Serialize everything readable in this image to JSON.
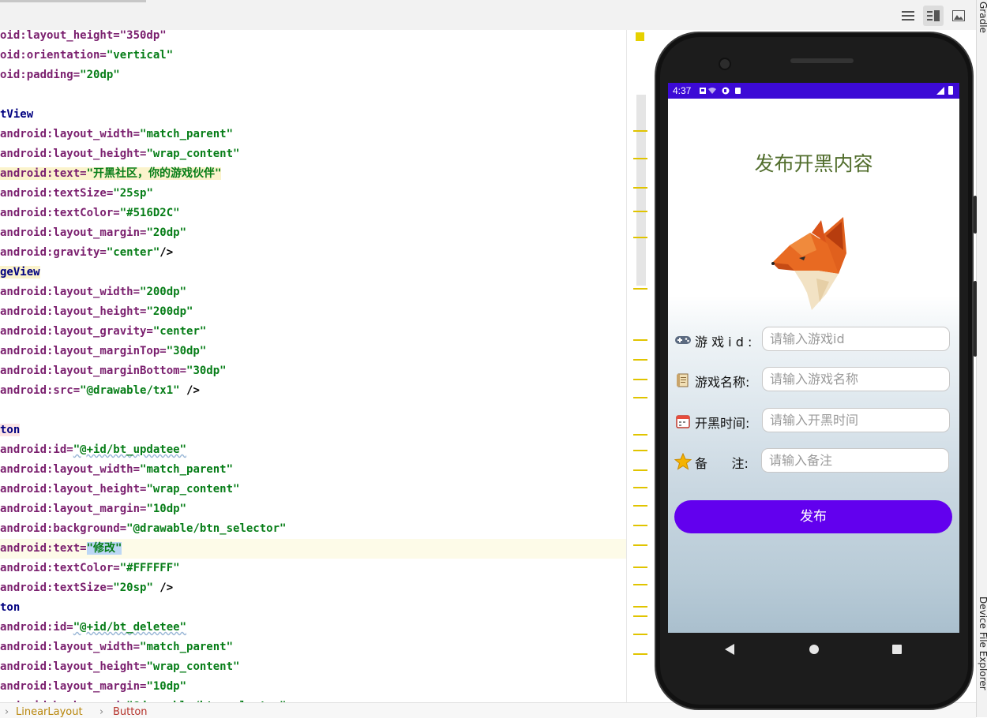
{
  "ide": {
    "side_labels": {
      "gradle": "Gradle",
      "device_explorer": "Device File Explorer"
    },
    "breadcrumb": [
      "LinearLayout",
      "Button"
    ],
    "code_lines": [
      {
        "parts": [
          [
            "attr",
            "oid:layout_height=\"350dp\""
          ]
        ]
      },
      {
        "parts": [
          [
            "attr",
            "oid:orientation="
          ],
          [
            "val",
            "\"vertical\""
          ]
        ]
      },
      {
        "parts": [
          [
            "attr",
            "oid:padding="
          ],
          [
            "val",
            "\"20dp\""
          ]
        ]
      },
      {
        "parts": []
      },
      {
        "parts": [
          [
            "tag",
            "tView"
          ]
        ]
      },
      {
        "parts": [
          [
            "attr",
            "android:layout_width="
          ],
          [
            "val",
            "\"match_parent\""
          ]
        ]
      },
      {
        "parts": [
          [
            "attr",
            "android:layout_height="
          ],
          [
            "val",
            "\"wrap_content\""
          ]
        ]
      },
      {
        "parts": [
          [
            "attr",
            "android:text="
          ],
          [
            "val",
            "\"开黑社区，你的游戏伙伴\""
          ]
        ],
        "hl": "hl"
      },
      {
        "parts": [
          [
            "attr",
            "android:textSize="
          ],
          [
            "val",
            "\"25sp\""
          ]
        ]
      },
      {
        "parts": [
          [
            "attr",
            "android:textColor="
          ],
          [
            "val",
            "\"#516D2C\""
          ]
        ]
      },
      {
        "parts": [
          [
            "attr",
            "android:layout_margin="
          ],
          [
            "val",
            "\"20dp\""
          ]
        ]
      },
      {
        "parts": [
          [
            "attr",
            "android:gravity="
          ],
          [
            "val",
            "\"center\""
          ],
          [
            "plain",
            "/>"
          ]
        ]
      },
      {
        "parts": [
          [
            "tag",
            "geView"
          ]
        ],
        "hl": "hl-tag"
      },
      {
        "parts": [
          [
            "attr",
            "android:layout_width="
          ],
          [
            "val",
            "\"200dp\""
          ]
        ]
      },
      {
        "parts": [
          [
            "attr",
            "android:layout_height="
          ],
          [
            "val",
            "\"200dp\""
          ]
        ]
      },
      {
        "parts": [
          [
            "attr",
            "android:layout_gravity="
          ],
          [
            "val",
            "\"center\""
          ]
        ]
      },
      {
        "parts": [
          [
            "attr",
            "android:layout_marginTop="
          ],
          [
            "val",
            "\"30dp\""
          ]
        ]
      },
      {
        "parts": [
          [
            "attr",
            "android:layout_marginBottom="
          ],
          [
            "val",
            "\"30dp\""
          ]
        ]
      },
      {
        "parts": [
          [
            "attr",
            "android:src="
          ],
          [
            "val",
            "\"@drawable/tx1\""
          ],
          [
            "plain",
            " />"
          ]
        ]
      },
      {
        "parts": []
      },
      {
        "parts": [
          [
            "tag",
            "ton"
          ]
        ],
        "hl": "hl-pink"
      },
      {
        "parts": [
          [
            "attr",
            "android:id="
          ],
          [
            "val",
            "\"@+id/bt_updatee\""
          ]
        ]
      },
      {
        "parts": [
          [
            "attr",
            "android:layout_width="
          ],
          [
            "val",
            "\"match_parent\""
          ]
        ]
      },
      {
        "parts": [
          [
            "attr",
            "android:layout_height="
          ],
          [
            "val",
            "\"wrap_content\""
          ]
        ]
      },
      {
        "parts": [
          [
            "attr",
            "android:layout_margin="
          ],
          [
            "val",
            "\"10dp\""
          ]
        ]
      },
      {
        "parts": [
          [
            "attr",
            "android:background="
          ],
          [
            "val",
            "\"@drawable/btn_selector\""
          ]
        ]
      },
      {
        "parts": [
          [
            "attr",
            "android:text="
          ],
          [
            "val",
            "\"修改\""
          ]
        ],
        "hl": "hl-cur"
      },
      {
        "parts": [
          [
            "attr",
            "android:textColor="
          ],
          [
            "val",
            "\"#FFFFFF\""
          ]
        ]
      },
      {
        "parts": [
          [
            "attr",
            "android:textSize="
          ],
          [
            "val",
            "\"20sp\""
          ],
          [
            "plain",
            " />"
          ]
        ]
      },
      {
        "parts": [
          [
            "tag",
            "ton"
          ]
        ]
      },
      {
        "parts": [
          [
            "attr",
            "android:id="
          ],
          [
            "val",
            "\"@+id/bt_deletee\""
          ]
        ]
      },
      {
        "parts": [
          [
            "attr",
            "android:layout_width="
          ],
          [
            "val",
            "\"match_parent\""
          ]
        ]
      },
      {
        "parts": [
          [
            "attr",
            "android:layout_height="
          ],
          [
            "val",
            "\"wrap_content\""
          ]
        ]
      },
      {
        "parts": [
          [
            "attr",
            "android:layout_margin="
          ],
          [
            "val",
            "\"10dp\""
          ]
        ]
      },
      {
        "parts": [
          [
            "attr",
            "android:background="
          ],
          [
            "val",
            "\"@drawable/btn_selector\""
          ]
        ]
      }
    ]
  },
  "phone": {
    "status_time": "4:37",
    "title": "发布开黑内容",
    "title_color": "#516D2C",
    "form": [
      {
        "icon": "gamepad-icon",
        "label": "游 戏 i d :",
        "placeholder": "请输入游戏id"
      },
      {
        "icon": "scroll-icon",
        "label": "游戏名称:",
        "placeholder": "请输入游戏名称"
      },
      {
        "icon": "calendar-icon",
        "label": "开黑时间:",
        "placeholder": "请输入开黑时间"
      },
      {
        "icon": "star-icon",
        "label": "备      注:",
        "placeholder": "请输入备注"
      }
    ],
    "publish_label": "发布",
    "accent_color": "#6200ee",
    "status_color": "#3c0ad6"
  }
}
